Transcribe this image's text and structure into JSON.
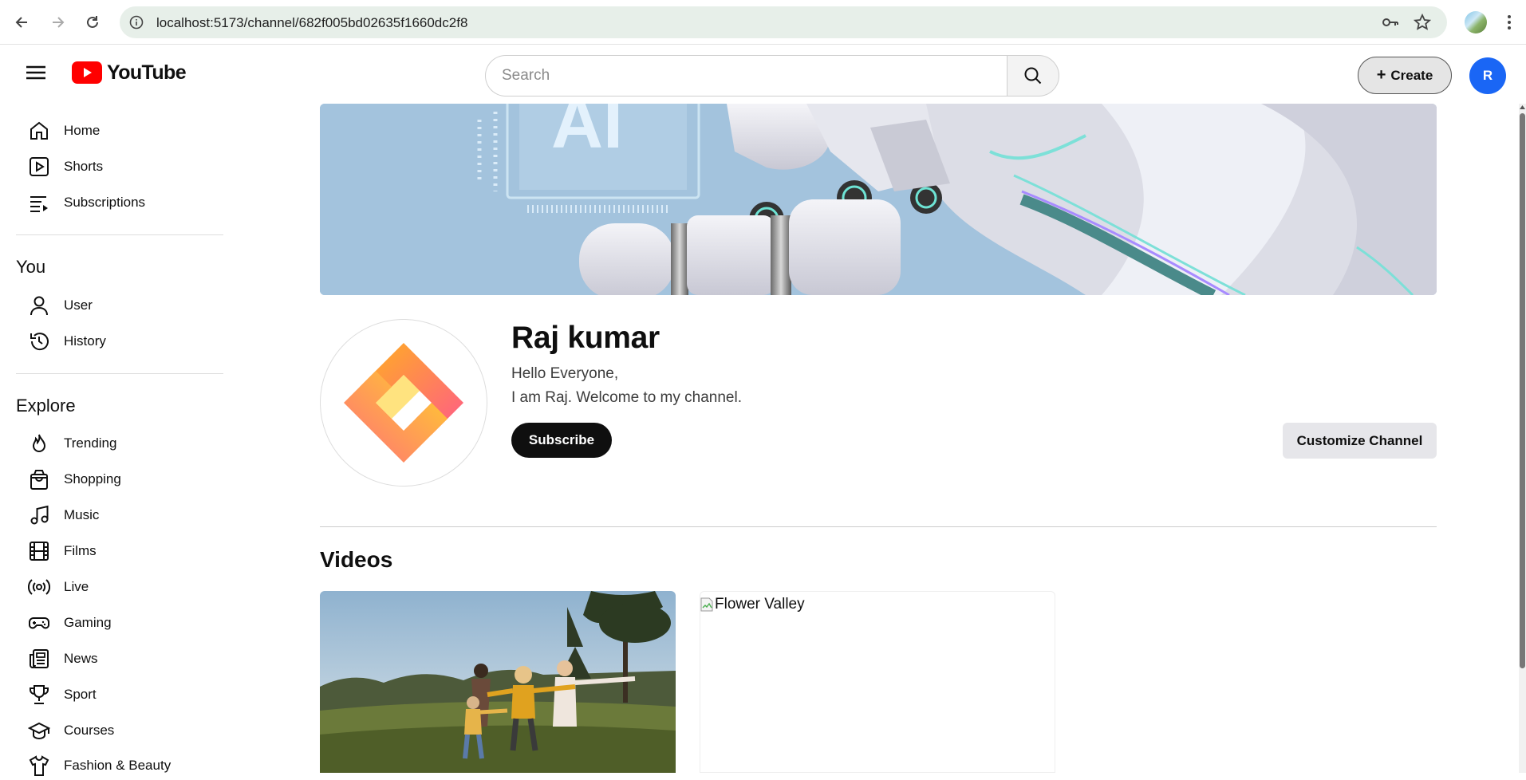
{
  "browser": {
    "url": "localhost:5173/channel/682f005bd02635f1660dc2f8"
  },
  "header": {
    "logo_text": "YouTube",
    "search_placeholder": "Search",
    "create_label": "Create",
    "create_prefix": "+",
    "avatar_initial": "R"
  },
  "sidebar": {
    "primary": [
      {
        "label": "Home",
        "icon": "home-icon"
      },
      {
        "label": "Shorts",
        "icon": "shorts-icon"
      },
      {
        "label": "Subscriptions",
        "icon": "subscriptions-icon"
      }
    ],
    "you_title": "You",
    "you": [
      {
        "label": "User",
        "icon": "user-icon"
      },
      {
        "label": "History",
        "icon": "history-icon"
      }
    ],
    "explore_title": "Explore",
    "explore": [
      {
        "label": "Trending",
        "icon": "flame-icon"
      },
      {
        "label": "Shopping",
        "icon": "shopping-bag-icon"
      },
      {
        "label": "Music",
        "icon": "music-note-icon"
      },
      {
        "label": "Films",
        "icon": "film-icon"
      },
      {
        "label": "Live",
        "icon": "live-broadcast-icon"
      },
      {
        "label": "Gaming",
        "icon": "gamepad-icon"
      },
      {
        "label": "News",
        "icon": "newspaper-icon"
      },
      {
        "label": "Sport",
        "icon": "trophy-icon"
      },
      {
        "label": "Courses",
        "icon": "graduation-cap-icon"
      },
      {
        "label": "Fashion & Beauty",
        "icon": "shirt-icon"
      }
    ]
  },
  "channel": {
    "banner_text": "AI",
    "name": "Raj kumar",
    "description_line1": "Hello Everyone,",
    "description_line2": "I am Raj. Welcome to my channel.",
    "subscribe_label": "Subscribe",
    "customize_label": "Customize Channel"
  },
  "videos": {
    "title": "Videos",
    "items": [
      {
        "alt": ""
      },
      {
        "alt": "Flower Valley"
      }
    ]
  },
  "colors": {
    "youtube_red": "#ff0000",
    "avatar_blue": "#1a66f5",
    "banner_bg": "#a3c3dd"
  }
}
